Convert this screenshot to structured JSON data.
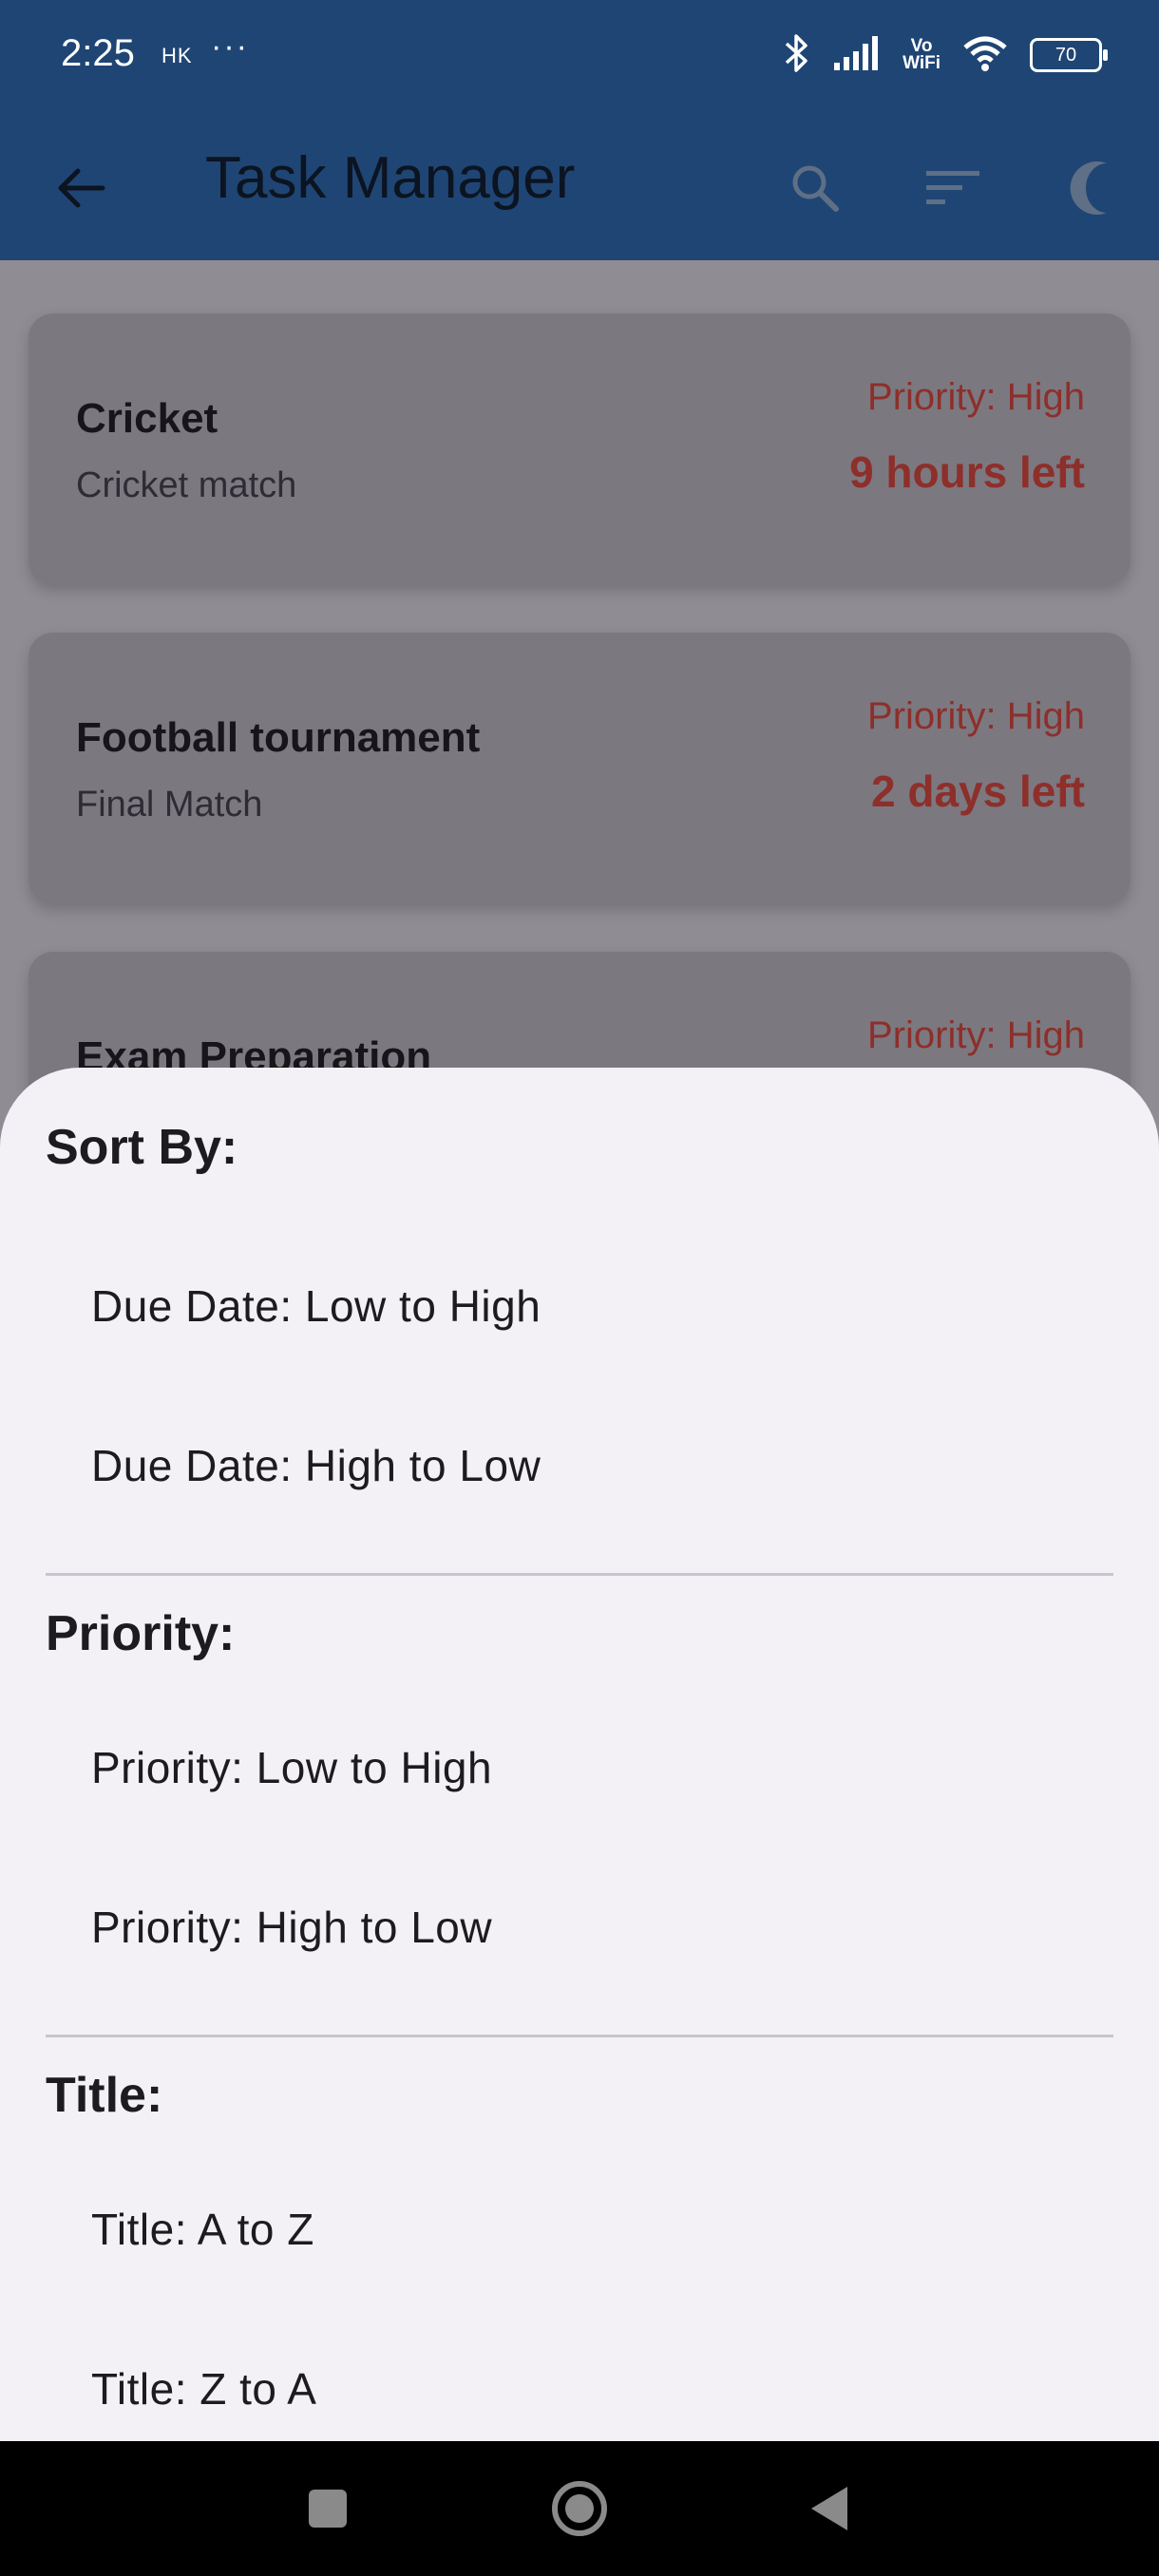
{
  "status_bar": {
    "time": "2:25",
    "carrier": "HK",
    "more": "···",
    "vowifi_top": "Vo",
    "vowifi_bottom": "WiFi",
    "battery": "70",
    "icons": [
      "bluetooth-icon",
      "signal-icon",
      "vowifi-icon",
      "wifi-icon",
      "battery-icon"
    ]
  },
  "app_bar": {
    "title": "Task Manager",
    "icons": [
      "back-arrow-icon",
      "search-icon",
      "sort-icon",
      "dark-mode-icon"
    ]
  },
  "tasks": [
    {
      "title": "Cricket",
      "description": "Cricket match",
      "priority": "Priority: High",
      "due": "9 hours left"
    },
    {
      "title": "Football tournament",
      "description": "Final Match",
      "priority": "Priority: High",
      "due": "2 days left"
    },
    {
      "title": "Exam Preparation",
      "description": "",
      "priority": "Priority: High",
      "due": ""
    }
  ],
  "sort_sheet": {
    "sections": [
      {
        "heading": "Sort By:",
        "options": [
          "Due Date: Low to High",
          "Due Date: High to Low"
        ]
      },
      {
        "heading": "Priority:",
        "options": [
          "Priority: Low to High",
          "Priority: High to Low"
        ]
      },
      {
        "heading": "Title:",
        "options": [
          "Title: A to Z",
          "Title: Z to A"
        ]
      }
    ]
  },
  "nav_bar": {
    "icons": [
      "recents-square-icon",
      "home-circle-icon",
      "back-triangle-icon"
    ]
  },
  "colors": {
    "app_bar": "#1f4574",
    "priority_text": "#8d2f2a",
    "sheet_bg": "#f3f0f6",
    "scrim": "#8f8c93"
  }
}
